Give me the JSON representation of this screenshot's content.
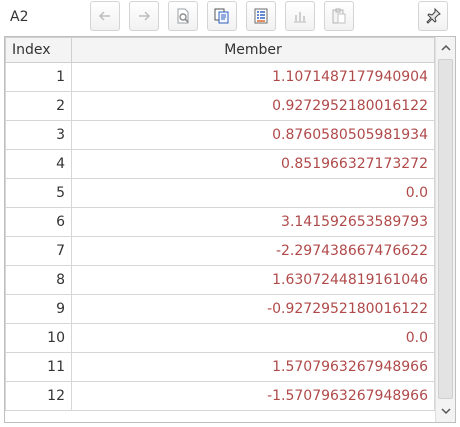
{
  "toolbar": {
    "cell_ref": "A2",
    "buttons": [
      "back-icon",
      "forward-icon",
      "preview-icon",
      "copy-icon",
      "list-icon",
      "chart-icon",
      "paste-icon",
      "pin-icon"
    ]
  },
  "table": {
    "headers": {
      "index": "Index",
      "member": "Member"
    },
    "rows": [
      {
        "index": "1",
        "member": "1.1071487177940904"
      },
      {
        "index": "2",
        "member": "0.9272952180016122"
      },
      {
        "index": "3",
        "member": "0.8760580505981934"
      },
      {
        "index": "4",
        "member": "0.851966327173272"
      },
      {
        "index": "5",
        "member": "0.0"
      },
      {
        "index": "6",
        "member": "3.141592653589793"
      },
      {
        "index": "7",
        "member": "-2.297438667476622"
      },
      {
        "index": "8",
        "member": "1.6307244819161046"
      },
      {
        "index": "9",
        "member": "-0.9272952180016122"
      },
      {
        "index": "10",
        "member": "0.0"
      },
      {
        "index": "11",
        "member": "1.5707963267948966"
      },
      {
        "index": "12",
        "member": "-1.5707963267948966"
      }
    ]
  },
  "colors": {
    "member_text": "#b04a4a",
    "header_bg": "#f4f4f4",
    "grid_line": "#d6d6d6"
  }
}
